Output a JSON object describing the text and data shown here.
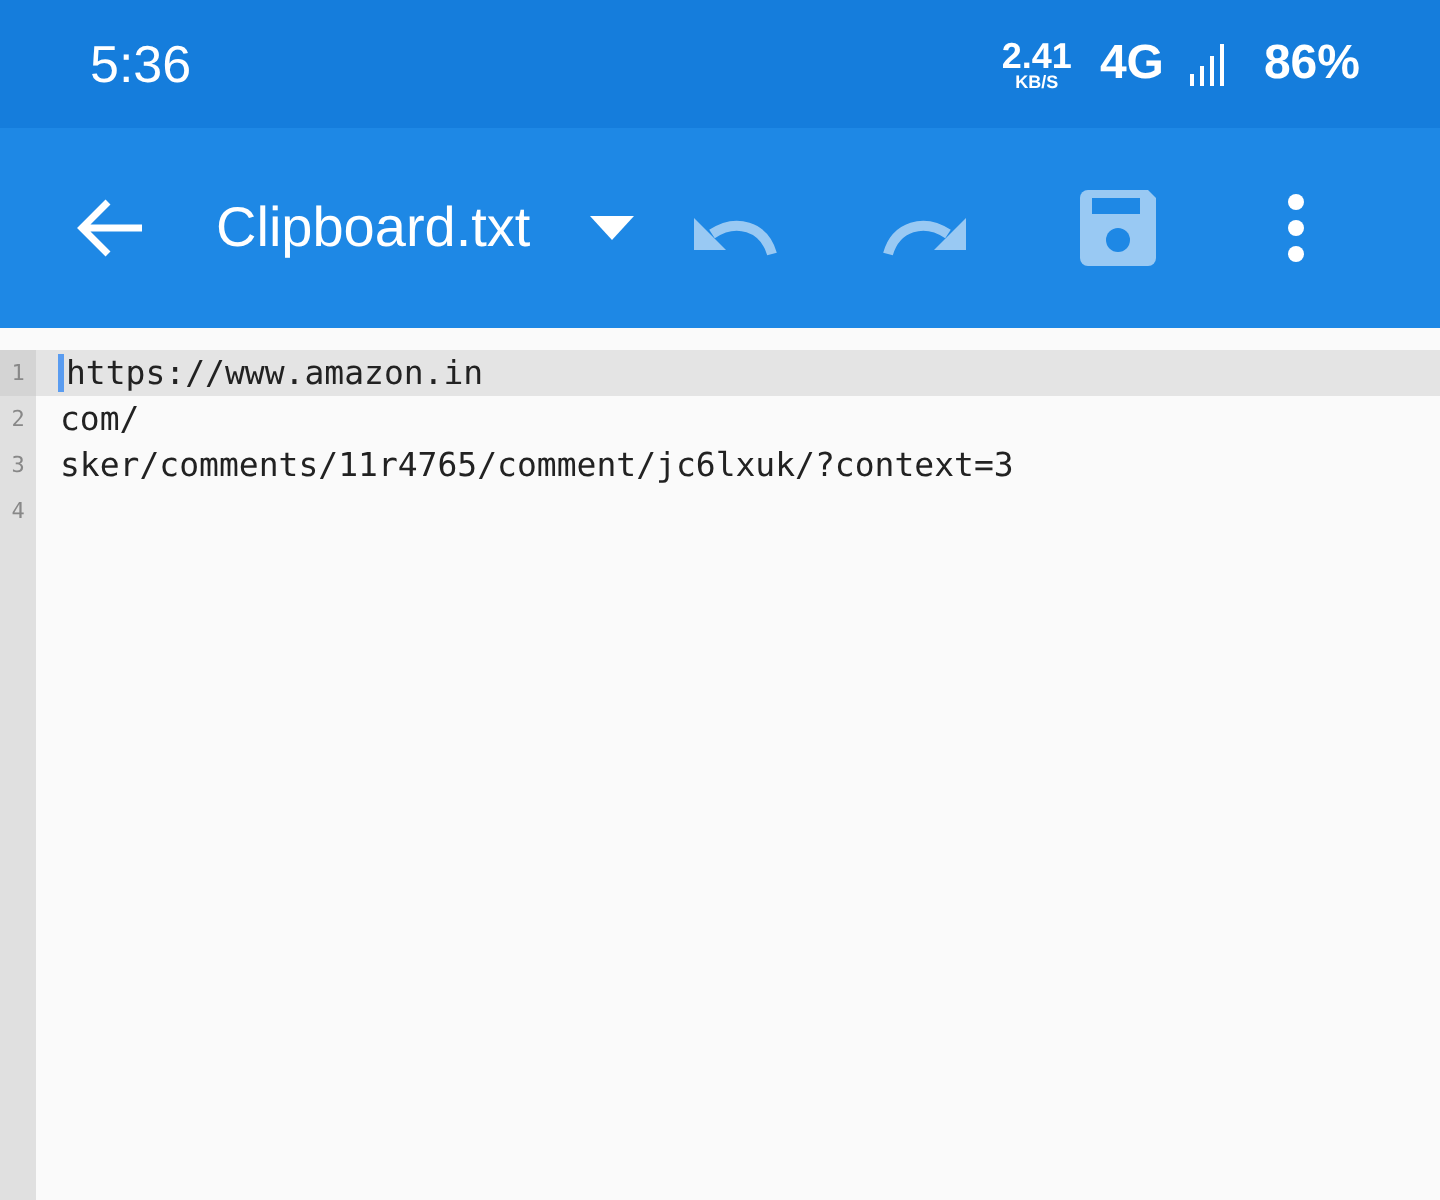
{
  "status_bar": {
    "time": "5:36",
    "net_speed": "2.41",
    "net_unit": "KB/S",
    "network": "4G",
    "battery": "86%"
  },
  "toolbar": {
    "title": "Clipboard.txt",
    "undo_enabled": false,
    "redo_enabled": false,
    "save_enabled": false
  },
  "editor": {
    "lines": [
      {
        "number": "1",
        "text": "https://www.amazon.in",
        "current": true
      },
      {
        "number": "2",
        "text": "com/",
        "current": false
      },
      {
        "number": "3",
        "text": "sker/comments/11r4765/comment/jc6lxuk/?context=3",
        "current": false
      },
      {
        "number": "4",
        "current": false
      }
    ]
  }
}
